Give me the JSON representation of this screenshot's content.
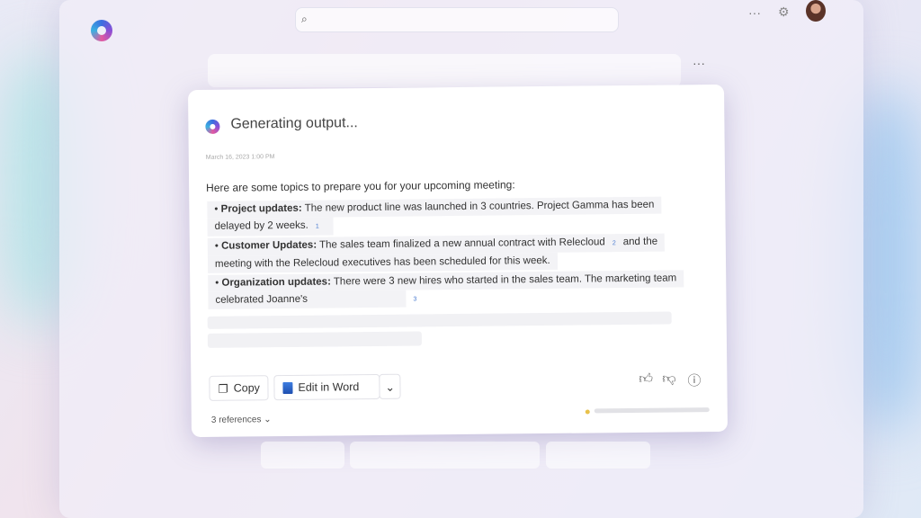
{
  "card": {
    "title": "Generating output...",
    "date": "March 16, 2023 1:00 PM",
    "intro": "Here are some topics to prepare you for your upcoming meeting:",
    "bullets": [
      {
        "label": "Project updates:",
        "line1": " The new product line was launched in 3 countries. Project Gamma has been",
        "line2": "delayed by 2 weeks.",
        "cite": "1"
      },
      {
        "label": "Customer Updates:",
        "line1": " The sales team finalized a new annual contract with Relecloud",
        "cite": "2",
        "line1b": "and the",
        "line2": "meeting with the Relecloud executives has been scheduled for this week."
      },
      {
        "label": "Organization updates:",
        "line1": " There were 3 new hires who started in the sales team. The marketing team",
        "line2": "celebrated Joanne's",
        "cite": "3"
      }
    ],
    "copy_label": "Copy",
    "edit_label": "Edit in Word",
    "references": "3 references",
    "progress_percent": 5
  },
  "icons": [
    "copilot-logo",
    "search-icon",
    "more-icon",
    "gear-icon",
    "copy-icon",
    "word-icon",
    "chevron-down-icon",
    "thumbs-up-icon",
    "thumbs-down-icon",
    "feedback-icon"
  ]
}
